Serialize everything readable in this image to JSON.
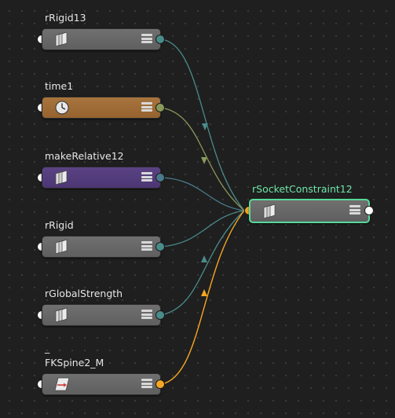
{
  "nodes": [
    {
      "id": "rRigid13",
      "label": "rRigid13",
      "icon": "rigid-stack-icon",
      "style": "gray",
      "out_color": "#4a8c8a"
    },
    {
      "id": "time1",
      "label": "time1",
      "icon": "clock-icon",
      "style": "orange",
      "out_color": "#8a9a5b"
    },
    {
      "id": "makeRelative12",
      "label": "makeRelative12",
      "icon": "rigid-stack-icon",
      "style": "purple",
      "out_color": "#4a7a8c"
    },
    {
      "id": "rRigid",
      "label": "rRigid",
      "icon": "rigid-stack-icon",
      "style": "gray",
      "out_color": "#4a8c8a"
    },
    {
      "id": "rGlobalStrength",
      "label": "rGlobalStrength",
      "icon": "rigid-stack-icon",
      "style": "gray",
      "out_color": "#4a8c8a"
    },
    {
      "id": "FKSpine2_M",
      "label": "FKSpine2_M",
      "label_prefix": "_",
      "icon": "transform-icon",
      "style": "gray",
      "out_color": "#f6a623"
    }
  ],
  "target": {
    "id": "rSocketConstraint12",
    "label": "rSocketConstraint12",
    "icon": "rigid-stack-icon",
    "selected": true,
    "accent": "#57d99a"
  },
  "colors": {
    "background": "#1f1f1f",
    "wire_teal": "#4a8c8a",
    "wire_olive": "#8a9a5b",
    "wire_orange": "#f6a623",
    "selection": "#57d99a"
  }
}
